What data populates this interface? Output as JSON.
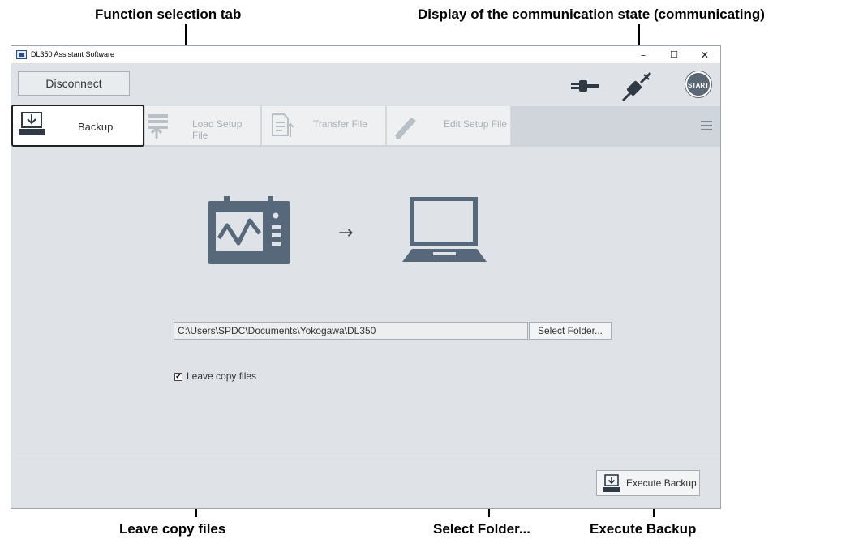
{
  "annotations": {
    "function_tab": "Function selection tab",
    "comm_state": "Display of the communication state (communicating)",
    "leave_copy": "Leave copy files",
    "select_folder": "Select Folder...",
    "execute": "Execute Backup"
  },
  "window": {
    "title": "DL350 Assistant Software",
    "minimize": "–",
    "maximize": "☐",
    "close": "✕"
  },
  "toolbar": {
    "disconnect": "Disconnect",
    "start": "START"
  },
  "tabs": [
    {
      "label": "Backup",
      "icon": "backup-icon",
      "active": true
    },
    {
      "label": "Load Setup File",
      "icon": "load-setup-icon",
      "active": false
    },
    {
      "label": "Transfer File",
      "icon": "transfer-file-icon",
      "active": false
    },
    {
      "label": "Edit Setup File",
      "icon": "edit-pencil-icon",
      "active": false
    }
  ],
  "main": {
    "arrow": "→",
    "path": "C:\\Users\\SPDC\\Documents\\Yokogawa\\DL350",
    "select_folder": "Select Folder...",
    "leave_copy_label": "Leave copy files",
    "leave_copy_checked": true,
    "check_glyph": "✔"
  },
  "footer": {
    "execute_label": "Execute Backup"
  },
  "colors": {
    "background": "#dfe3e7",
    "tabbar": "#cfd5db",
    "icon_dark": "#5b6b7a",
    "accent_blue": "#2c4d7a"
  }
}
